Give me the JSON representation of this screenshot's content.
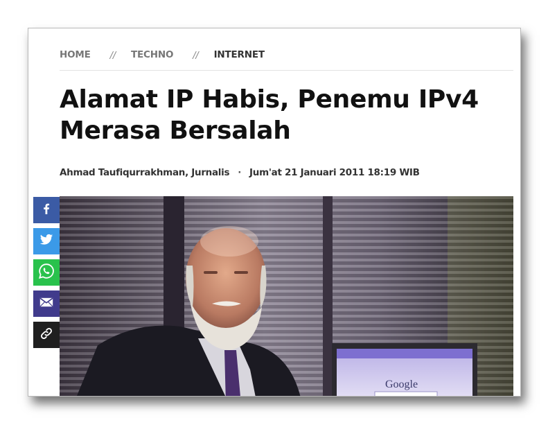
{
  "breadcrumb": {
    "items": [
      {
        "label": "HOME"
      },
      {
        "label": "TECHNO"
      },
      {
        "label": "INTERNET"
      }
    ],
    "separator": "//"
  },
  "article": {
    "title": "Alamat IP Habis, Penemu IPv4 Merasa Bersalah",
    "author": "Ahmad Taufiqurrakhman, Jurnalis",
    "meta_separator": "·",
    "date": "Jum'at 21 Januari 2011 18:19 WIB"
  },
  "hero_image": {
    "screen_text": "Google"
  },
  "share": {
    "buttons": [
      {
        "icon": "facebook-icon",
        "color": "#3b5ba5"
      },
      {
        "icon": "twitter-icon",
        "color": "#3b9ae8"
      },
      {
        "icon": "whatsapp-icon",
        "color": "#29c24c"
      },
      {
        "icon": "email-icon",
        "color": "#403b8c"
      },
      {
        "icon": "link-icon",
        "color": "#1f1f1f"
      }
    ]
  }
}
